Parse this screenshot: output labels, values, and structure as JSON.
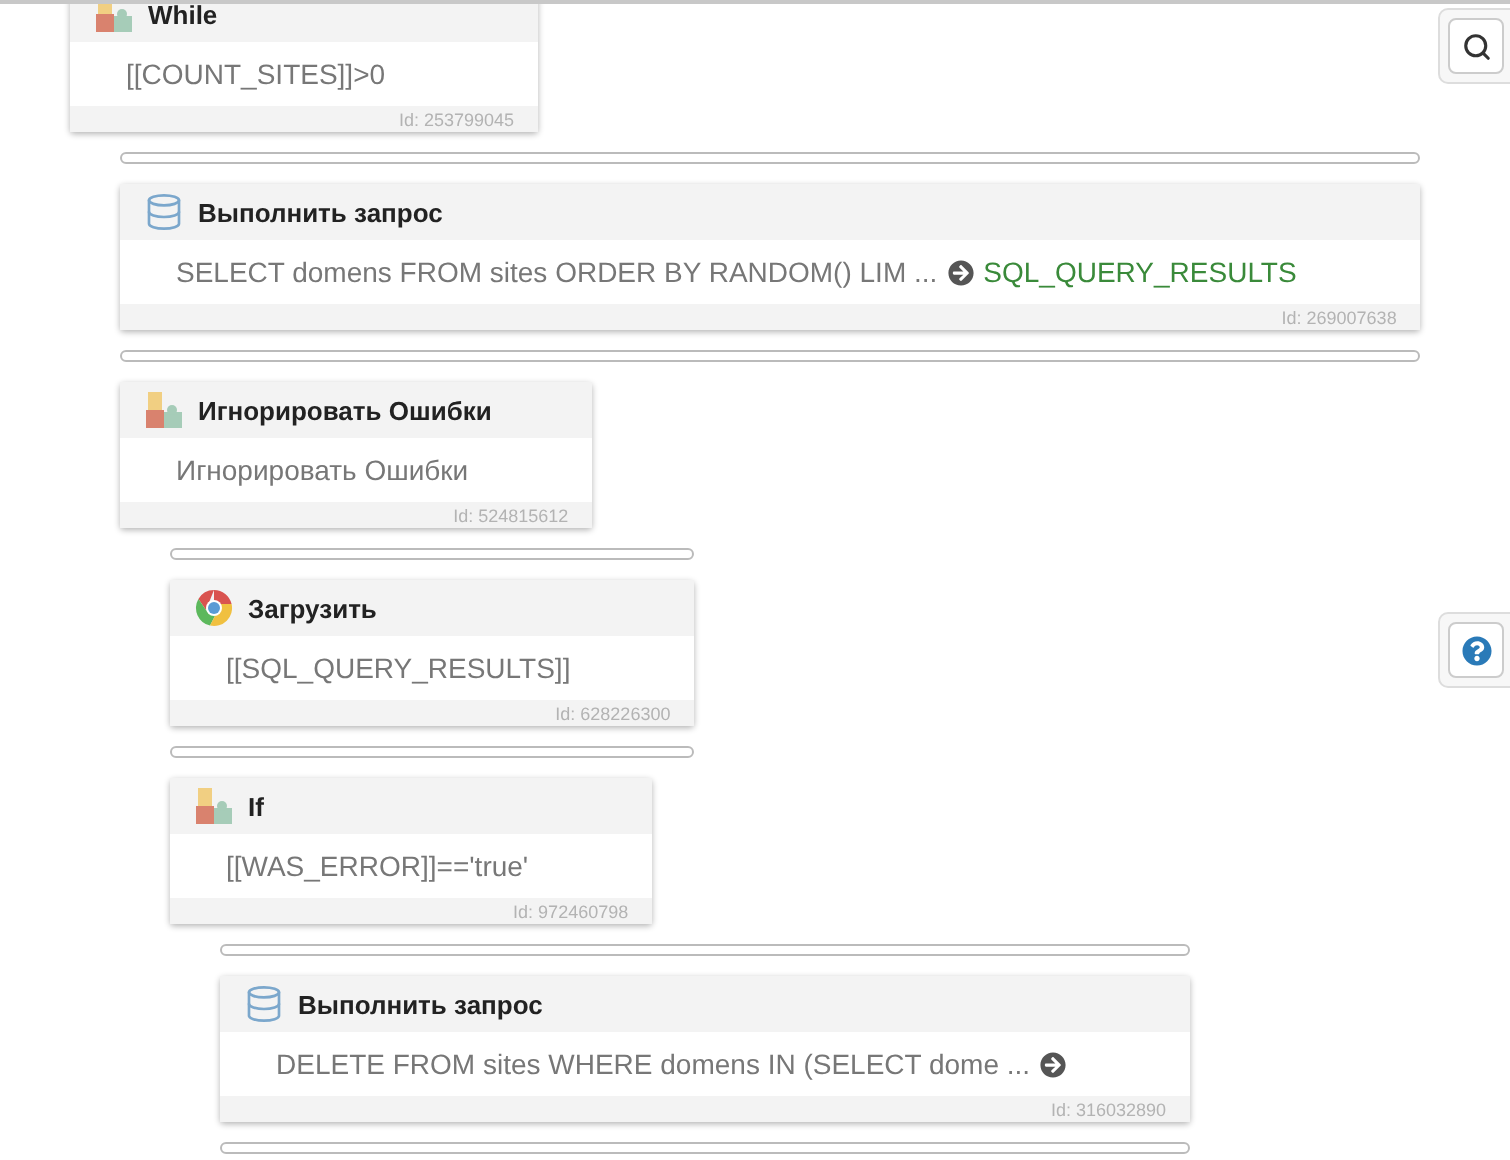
{
  "blocks": [
    {
      "kind": "puzzle",
      "title": "While",
      "body": "[[COUNT_SITES]]>0",
      "id_label": "Id: 253799045",
      "children": [
        {
          "kind": "database",
          "title": "Выполнить запрос",
          "body": "SELECT domens FROM sites ORDER BY RANDOM() LIM ...",
          "result_arrow": true,
          "output": "SQL_QUERY_RESULTS",
          "id_label": "Id: 269007638"
        },
        {
          "kind": "puzzle",
          "title": "Игнорировать Ошибки",
          "body": "Игнорировать Ошибки",
          "id_label": "Id: 524815612",
          "children": [
            {
              "kind": "chrome",
              "title": "Загрузить",
              "body": "[[SQL_QUERY_RESULTS]]",
              "id_label": "Id: 628226300"
            },
            {
              "kind": "puzzle",
              "title": "If",
              "body": "[[WAS_ERROR]]=='true'",
              "id_label": "Id: 972460798",
              "children": [
                {
                  "kind": "database",
                  "title": "Выполнить запрос",
                  "body": "DELETE FROM sites WHERE domens IN (SELECT dome ...",
                  "result_arrow": true,
                  "id_label": "Id: 316032890"
                }
              ]
            }
          ]
        }
      ]
    }
  ]
}
